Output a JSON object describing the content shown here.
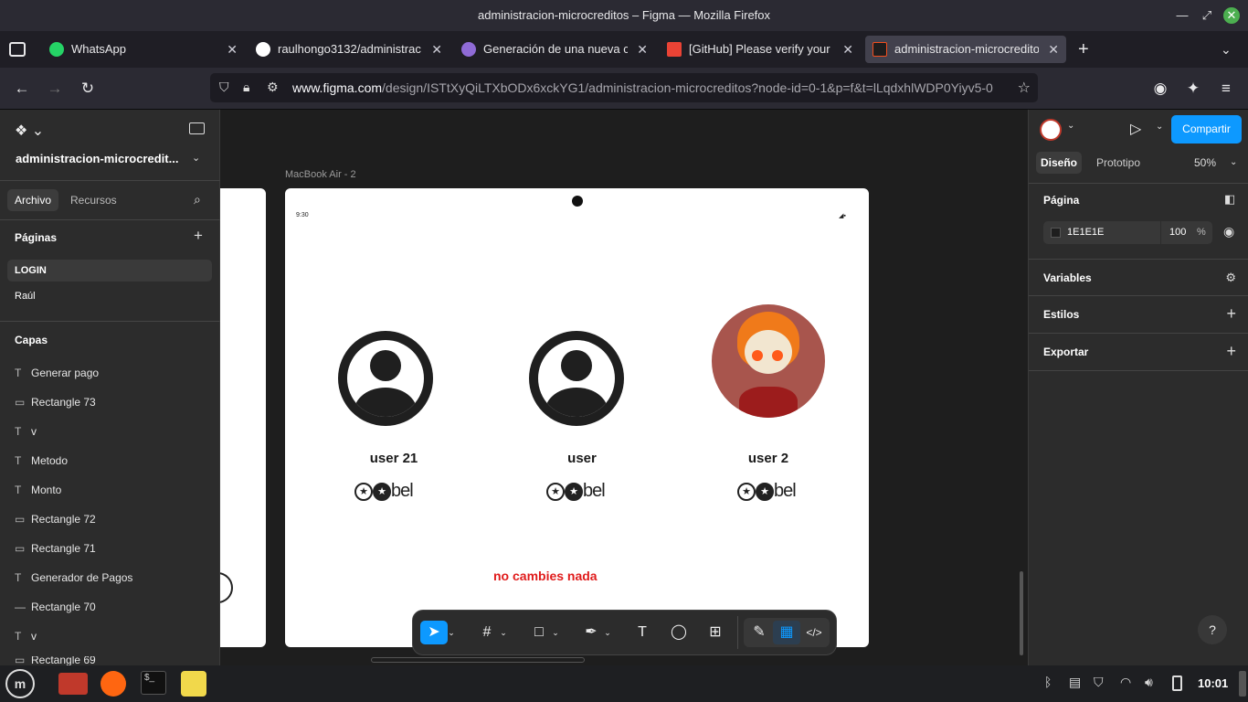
{
  "window": {
    "title": "administracion-microcreditos – Figma — Mozilla Firefox"
  },
  "tabs": [
    {
      "label": "WhatsApp",
      "icon": "whatsapp-icon",
      "color": "#25d366"
    },
    {
      "label": "raulhongo3132/administrac",
      "icon": "github-icon",
      "color": "#ffffff"
    },
    {
      "label": "Generación de una nueva cla",
      "icon": "github-icon",
      "color": "#8f6bd6"
    },
    {
      "label": "[GitHub] Please verify your d",
      "icon": "gmail-icon",
      "color": "#ea4335"
    },
    {
      "label": "administracion-microcredito",
      "icon": "figma-icon",
      "color": "#1e1e1e"
    }
  ],
  "nav": {
    "url_domain": "www.figma.com",
    "url_path": "/design/ISTtXyQiLTXbODx6xckYG1/administracion-microcreditos?node-id=0-1&p=f&t=lLqdxhlWDP0Yiyv5-0"
  },
  "left": {
    "file_name": "administracion-microcredit...",
    "tab_file": "Archivo",
    "tab_assets": "Recursos",
    "pages_title": "Páginas",
    "pages": [
      "LOGIN",
      "Raúl"
    ],
    "layers_title": "Capas",
    "layers": [
      {
        "type": "T",
        "name": "Generar pago"
      },
      {
        "type": "R",
        "name": "Rectangle 73"
      },
      {
        "type": "T",
        "name": "v"
      },
      {
        "type": "T",
        "name": "Metodo"
      },
      {
        "type": "T",
        "name": "Monto"
      },
      {
        "type": "R",
        "name": "Rectangle 72"
      },
      {
        "type": "R",
        "name": "Rectangle 71"
      },
      {
        "type": "T",
        "name": "Generador de Pagos"
      },
      {
        "type": "L",
        "name": "Rectangle 70"
      },
      {
        "type": "T",
        "name": "v"
      },
      {
        "type": "R",
        "name": "Rectangle 69"
      }
    ]
  },
  "canvas": {
    "frame_label": "MacBook Air - 2",
    "time": "9:30",
    "users": [
      {
        "name": "user 21",
        "badge": "bel"
      },
      {
        "name": "user",
        "badge": "bel"
      },
      {
        "name": "user 2",
        "badge": "bel"
      }
    ],
    "warning": "no cambies nada"
  },
  "right": {
    "share": "Compartir",
    "tab_design": "Diseño",
    "tab_prototype": "Prototipo",
    "zoom": "50%",
    "page_title": "Página",
    "bg_hex": "1E1E1E",
    "bg_opacity": "100",
    "pct": "%",
    "variables": "Variables",
    "styles": "Estilos",
    "export": "Exportar",
    "help": "?"
  },
  "taskbar": {
    "time": "10:01"
  },
  "colors": {
    "accent": "#0d99ff",
    "warning": "#e01b1b"
  }
}
